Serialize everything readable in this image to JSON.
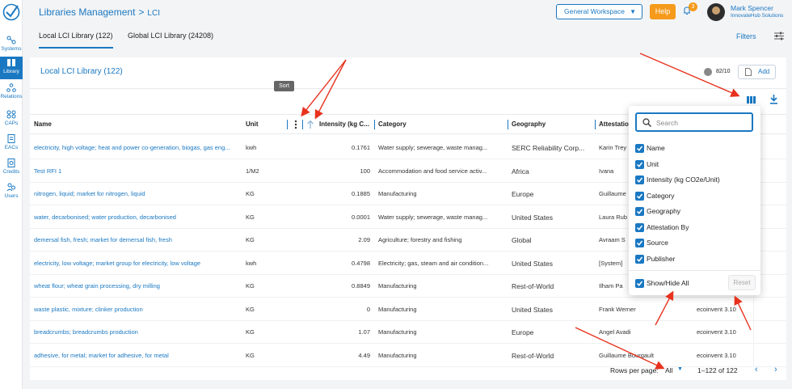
{
  "sidebar": {
    "items": [
      {
        "label": "Systems",
        "icon": "systems-icon"
      },
      {
        "label": "Library",
        "icon": "library-icon"
      },
      {
        "label": "Relations",
        "icon": "relations-icon"
      },
      {
        "label": "CAPs",
        "icon": "caps-icon"
      },
      {
        "label": "EACs",
        "icon": "eacs-icon"
      },
      {
        "label": "Credits",
        "icon": "credits-icon"
      },
      {
        "label": "Users",
        "icon": "users-icon"
      }
    ]
  },
  "header": {
    "breadcrumb_main": "Libraries Management",
    "breadcrumb_sep": ">",
    "breadcrumb_sub": "LCI",
    "workspace": "General Workspace",
    "help": "Help",
    "notifications": "3",
    "user_name": "Mark Spencer",
    "user_org": "InnovateHub Solutions"
  },
  "tabs": [
    {
      "label": "Local LCI Library (122)",
      "active": true
    },
    {
      "label": "Global LCI Library (24208)",
      "active": false
    }
  ],
  "filters_label": "Filters",
  "card": {
    "title": "Local LCI Library (122)",
    "rating": "82/10",
    "add_label": "Add"
  },
  "table": {
    "headers": {
      "name": "Name",
      "unit": "Unit",
      "intensity": "Intensity (kg C...",
      "category": "Category",
      "geography": "Geography",
      "attestation": "Attestation"
    },
    "sort_tooltip": "Sort",
    "rows": [
      {
        "name": "electricity, high voltage; heat and power co-generation, biogas, gas eng...",
        "unit": "kwh",
        "intensity": "0.1761",
        "category": "Water supply; sewerage, waste manag...",
        "geography": "SERC Reliability Corp...",
        "attestation": "Karin Trey",
        "source": ""
      },
      {
        "name": "Test RFI 1",
        "unit": "1/M2",
        "intensity": "100",
        "category": "Accommodation and food service activ...",
        "geography": "Africa",
        "attestation": "Ivana",
        "source": ""
      },
      {
        "name": "nitrogen, liquid; market for nitrogen, liquid",
        "unit": "KG",
        "intensity": "0.1885",
        "category": "Manufacturing",
        "geography": "Europe",
        "attestation": "Guillaume",
        "source": ""
      },
      {
        "name": "water, decarbonised; water production, decarbonised",
        "unit": "KG",
        "intensity": "0.0001",
        "category": "Water supply; sewerage, waste manag...",
        "geography": "United States",
        "attestation": "Laura Rub",
        "source": ""
      },
      {
        "name": "demersal fish, fresh; market for demersal fish, fresh",
        "unit": "KG",
        "intensity": "2.09",
        "category": "Agriculture; forestry and fishing",
        "geography": "Global",
        "attestation": "Avraam S",
        "source": ""
      },
      {
        "name": "electricity, low voltage; market group for electricity, low voltage",
        "unit": "kwh",
        "intensity": "0.4798",
        "category": "Electricity; gas, steam and air condition...",
        "geography": "United States",
        "attestation": "[System]",
        "source": ""
      },
      {
        "name": "wheat flour; wheat grain processing, dry milling",
        "unit": "KG",
        "intensity": "0.8849",
        "category": "Manufacturing",
        "geography": "Rest-of-World",
        "attestation": "Ilham Pa",
        "source": ""
      },
      {
        "name": "waste plastic, mixture; clinker production",
        "unit": "KG",
        "intensity": "0",
        "category": "Manufacturing",
        "geography": "United States",
        "attestation": "Frank Werner",
        "source": "ecoinvent 3.10"
      },
      {
        "name": "breadcrumbs; breadcrumbs production",
        "unit": "KG",
        "intensity": "1.07",
        "category": "Manufacturing",
        "geography": "Europe",
        "attestation": "Angel Avadi",
        "source": "ecoinvent 3.10"
      },
      {
        "name": "adhesive, for metal; market for adhesive, for metal",
        "unit": "KG",
        "intensity": "4.49",
        "category": "Manufacturing",
        "geography": "Rest-of-World",
        "attestation": "Guillaume Bourgault",
        "source": "ecoinvent 3.10"
      }
    ]
  },
  "footer": {
    "rows_per_page_label": "Rows per page:",
    "rows_per_page_value": "All",
    "range": "1–122 of 122"
  },
  "column_popup": {
    "search_placeholder": "Search",
    "options": [
      "Name",
      "Unit",
      "Intensity (kg CO2e/Unit)",
      "Category",
      "Geography",
      "Attestation By",
      "Source",
      "Publisher"
    ],
    "show_hide_all": "Show/Hide All",
    "reset": "Reset"
  },
  "colors": {
    "accent": "#1a78c2",
    "help": "#f59a1a",
    "annotation": "#e8321e"
  }
}
